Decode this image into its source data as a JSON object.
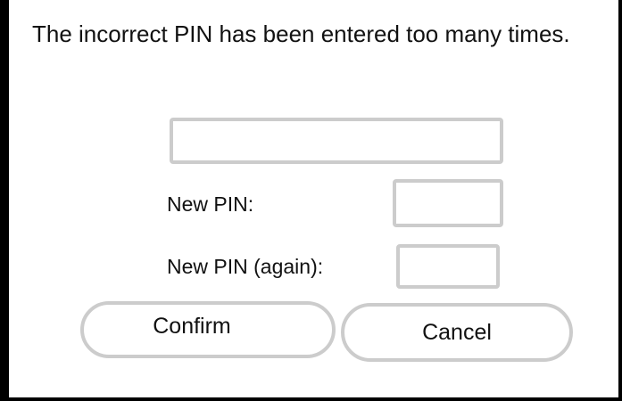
{
  "dialog": {
    "message": "The incorrect PIN has been entered too many times.",
    "pin_value": "",
    "new_pin_label": "New PIN:",
    "new_pin_value": "",
    "new_pin_again_label": "New PIN (again):",
    "new_pin_again_value": "",
    "confirm_label": "Confirm",
    "cancel_label": "Cancel"
  },
  "colors": {
    "border": "#000000",
    "field_border": "#cccccc",
    "background": "#ffffff",
    "text": "#111111"
  }
}
